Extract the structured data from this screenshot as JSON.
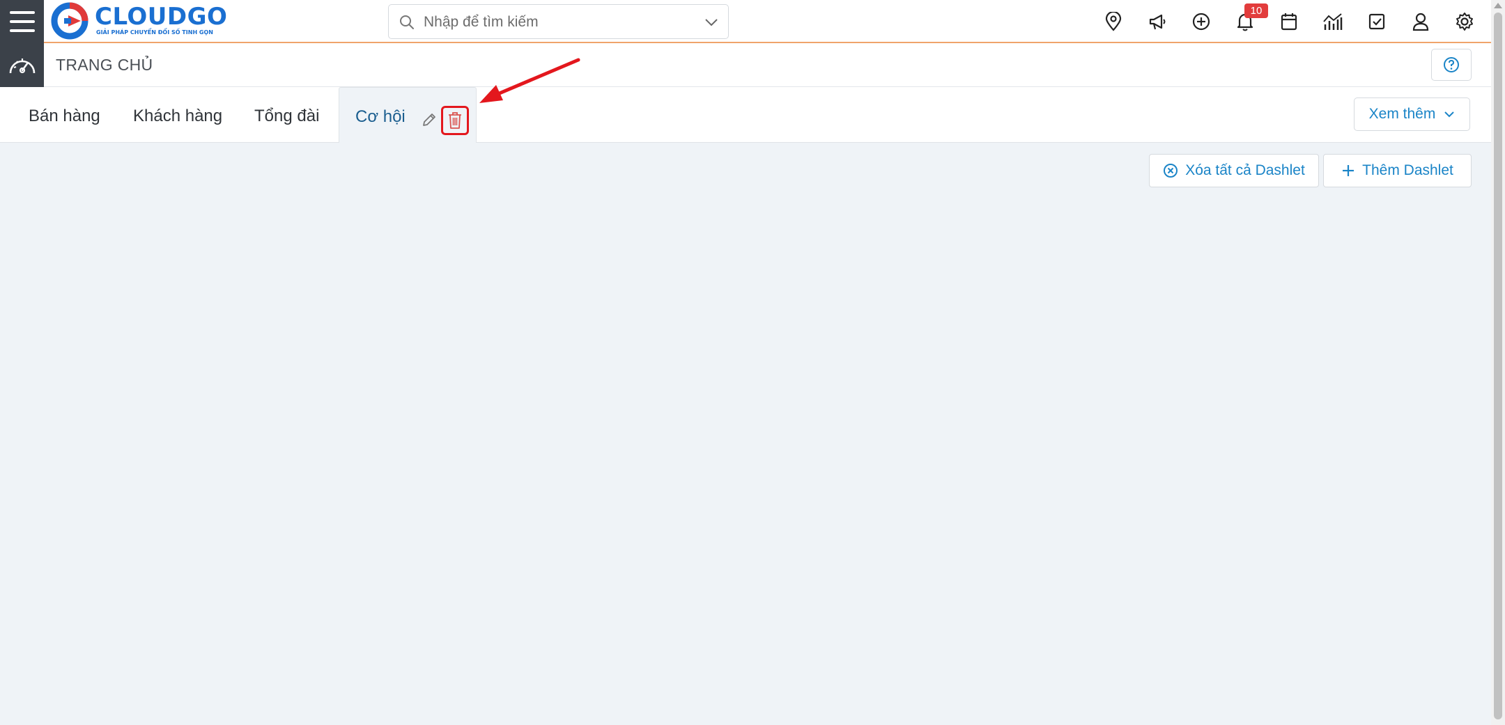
{
  "header": {
    "brand": "CLOUDGO",
    "tagline": "GIẢI PHÁP CHUYỂN ĐỔI SỐ TINH GỌN",
    "search_placeholder": "Nhập để tìm kiếm",
    "notification_count": "10",
    "icons": [
      "location-pin-icon",
      "megaphone-icon",
      "plus-circle-icon",
      "bell-icon",
      "calendar-icon",
      "report-chart-icon",
      "task-check-icon",
      "user-icon",
      "gear-icon"
    ]
  },
  "subbar": {
    "title": "TRANG CHỦ"
  },
  "tabs": [
    {
      "label": "Bán hàng"
    },
    {
      "label": "Khách hàng"
    },
    {
      "label": "Tổng đài"
    },
    {
      "label": "Cơ hội",
      "active": true
    }
  ],
  "more_label": "Xem thêm",
  "content": {
    "remove_all_label": "Xóa tất cả Dashlet",
    "add_label": "Thêm Dashlet"
  },
  "colors": {
    "accent": "#1a84c7",
    "header_dark": "#3b4149",
    "badge": "#e23c3c",
    "highlight": "#e3171d",
    "content_bg": "#eff3f7"
  }
}
